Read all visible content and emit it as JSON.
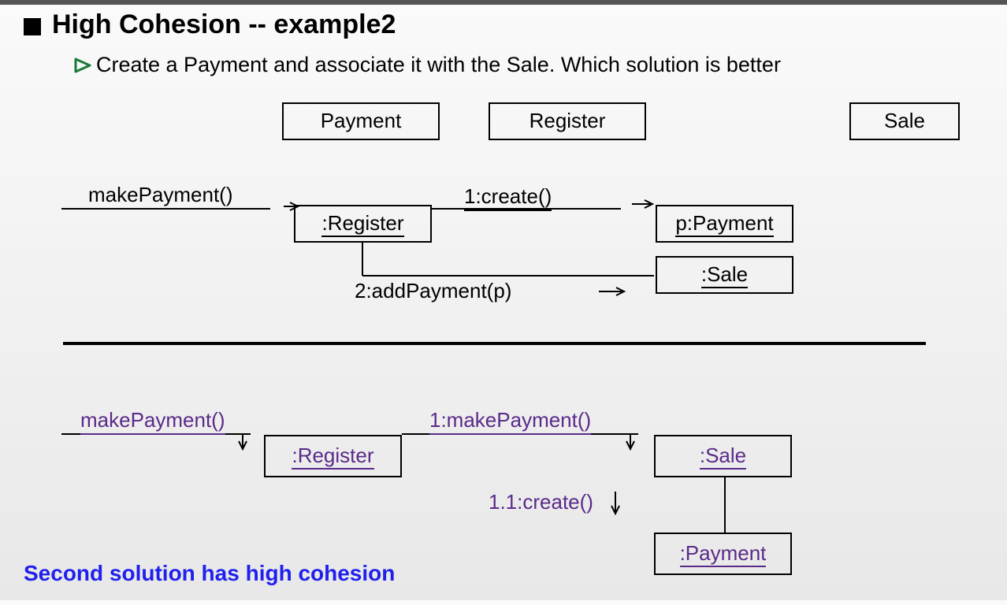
{
  "header": {
    "title": "High Cohesion  -- example2",
    "subtitle": "Create a Payment and associate it with the Sale. Which solution is better"
  },
  "classes": {
    "payment": "Payment",
    "register": "Register",
    "sale": "Sale"
  },
  "solution1": {
    "incoming": "makePayment()",
    "registerObj": ":Register",
    "msg1": "1:create()",
    "paymentObj": "p:Payment",
    "msg2": "2:addPayment(p)",
    "saleObj": ":Sale"
  },
  "solution2": {
    "incoming": "makePayment()",
    "registerObj": ":Register",
    "msg1": "1:makePayment()",
    "saleObj": ":Sale",
    "msg2": "1.1:create()",
    "paymentObj": ":Payment"
  },
  "footer": "Second solution has high cohesion"
}
